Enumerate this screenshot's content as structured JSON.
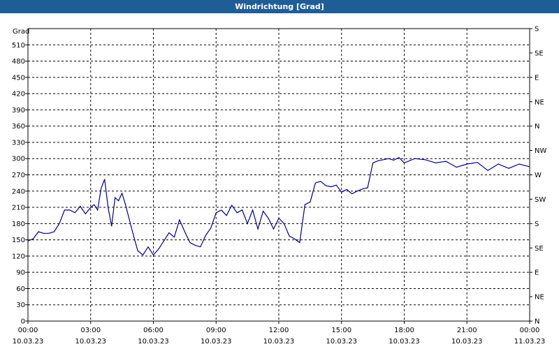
{
  "window": {
    "title": "Windrichtung [Grad]"
  },
  "chart_data": {
    "type": "line",
    "title": "Windrichtung [Grad]",
    "ylabel": "Grad",
    "ylim": [
      0,
      540
    ],
    "y_ticks": [
      0,
      30,
      60,
      90,
      120,
      150,
      180,
      210,
      240,
      270,
      300,
      330,
      360,
      390,
      420,
      450,
      480,
      510
    ],
    "xlim": [
      "10.03.23 00:00",
      "11.03.23 00:00"
    ],
    "x_ticks": [
      {
        "time": "00:00",
        "date": "10.03.23"
      },
      {
        "time": "03:00",
        "date": "10.03.23"
      },
      {
        "time": "06:00",
        "date": "10.03.23"
      },
      {
        "time": "09:00",
        "date": "10.03.23"
      },
      {
        "time": "12:00",
        "date": "10.03.23"
      },
      {
        "time": "15:00",
        "date": "10.03.23"
      },
      {
        "time": "18:00",
        "date": "10.03.23"
      },
      {
        "time": "21:00",
        "date": "10.03.23"
      },
      {
        "time": "00:00",
        "date": "11.03.23"
      }
    ],
    "right_axis_labels": [
      "N",
      "NE",
      "E",
      "SE",
      "S",
      "SW",
      "W",
      "NW",
      "N",
      "NE",
      "E",
      "SE",
      "S"
    ],
    "grid": true,
    "line_color": "#000080",
    "series": [
      {
        "x": [
          "00:00",
          "00:15",
          "00:30",
          "00:45",
          "01:00",
          "01:15",
          "01:30",
          "01:45",
          "02:00",
          "02:15",
          "02:30",
          "02:45",
          "03:00",
          "03:10",
          "03:20",
          "03:30",
          "03:40",
          "03:50",
          "04:00",
          "04:10",
          "04:20",
          "04:30",
          "04:40",
          "04:50",
          "05:00",
          "05:15",
          "05:30",
          "05:45",
          "06:00",
          "06:15",
          "06:30",
          "06:45",
          "07:00",
          "07:15",
          "07:30",
          "07:45",
          "08:00",
          "08:15",
          "08:30",
          "08:45",
          "09:00",
          "09:15",
          "09:30",
          "09:45",
          "10:00",
          "10:15",
          "10:30",
          "10:45",
          "11:00",
          "11:15",
          "11:30",
          "11:45",
          "12:00",
          "12:15",
          "12:30",
          "12:45",
          "13:00",
          "13:15",
          "13:30",
          "13:45",
          "14:00",
          "14:15",
          "14:30",
          "14:45",
          "15:00",
          "15:15",
          "15:30",
          "15:45",
          "16:00",
          "16:15",
          "16:30",
          "16:45",
          "17:00",
          "17:15",
          "17:30",
          "17:45",
          "18:00",
          "18:30",
          "19:00",
          "19:30",
          "20:00",
          "20:30",
          "21:00",
          "21:30",
          "22:00",
          "22:30",
          "23:00",
          "23:30",
          "24:00"
        ],
        "values": [
          148,
          152,
          165,
          162,
          162,
          165,
          180,
          205,
          205,
          200,
          212,
          198,
          210,
          215,
          205,
          245,
          262,
          210,
          175,
          228,
          222,
          236,
          215,
          190,
          165,
          130,
          122,
          137,
          122,
          133,
          148,
          163,
          155,
          187,
          165,
          145,
          140,
          137,
          158,
          172,
          200,
          205,
          195,
          214,
          200,
          205,
          180,
          205,
          170,
          203,
          190,
          170,
          190,
          180,
          157,
          152,
          145,
          215,
          220,
          255,
          258,
          250,
          248,
          251,
          238,
          243,
          235,
          240,
          244,
          246,
          292,
          296,
          298,
          300,
          297,
          302,
          292,
          300,
          298,
          292,
          295,
          284,
          290,
          293,
          278,
          290,
          282,
          290,
          285
        ]
      }
    ]
  }
}
